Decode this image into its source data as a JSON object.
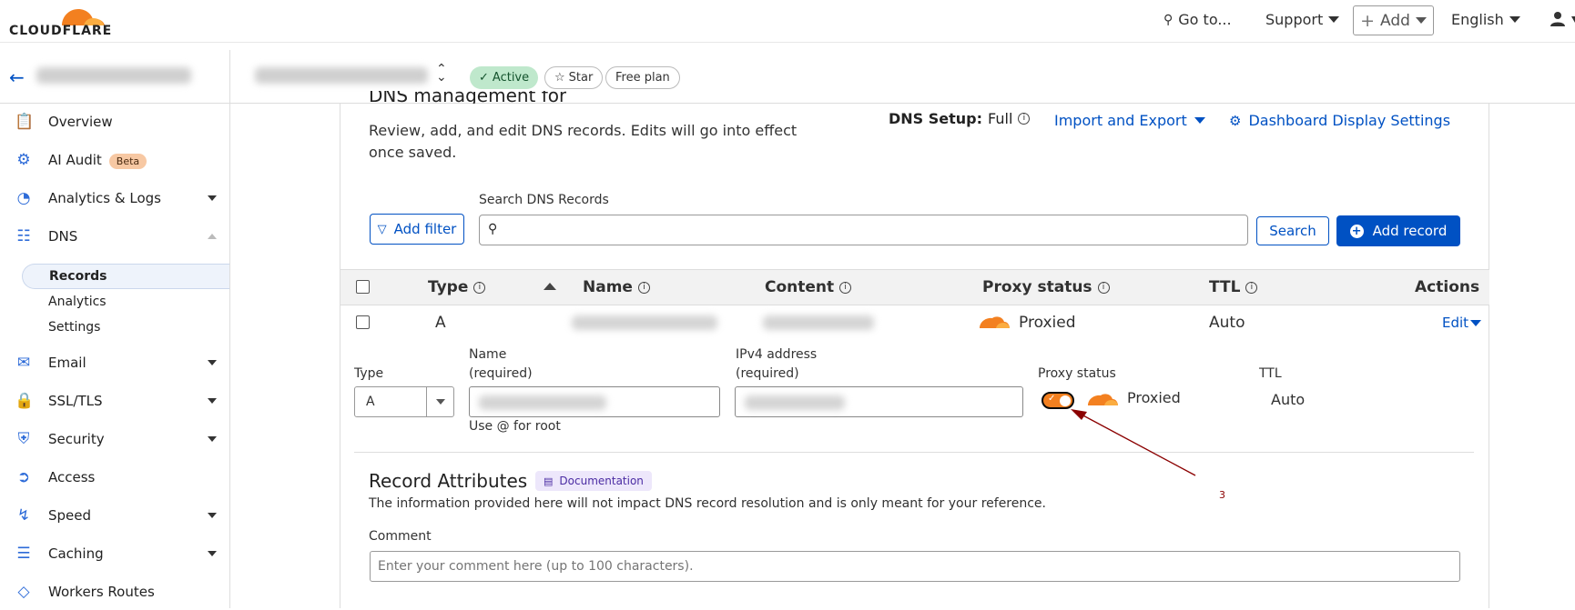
{
  "brand": {
    "logo_text": "CLOUDFLARE",
    "accent": "#f38020",
    "link_color": "#0051c3"
  },
  "topnav": {
    "goto": "Go to...",
    "support": "Support",
    "add": "Add",
    "language": "English"
  },
  "zone": {
    "status": "Active",
    "star": "Star",
    "plan": "Free plan"
  },
  "sidebar": {
    "items": [
      {
        "label": "Overview",
        "icon": "clipboard-icon"
      },
      {
        "label": "AI Audit",
        "icon": "robot-icon",
        "badge": "Beta"
      },
      {
        "label": "Analytics & Logs",
        "icon": "pie-chart-icon"
      },
      {
        "label": "DNS",
        "icon": "network-icon"
      },
      {
        "label": "Email",
        "icon": "envelope-icon"
      },
      {
        "label": "SSL/TLS",
        "icon": "lock-icon"
      },
      {
        "label": "Security",
        "icon": "shield-icon"
      },
      {
        "label": "Access",
        "icon": "access-icon"
      },
      {
        "label": "Speed",
        "icon": "bolt-icon"
      },
      {
        "label": "Caching",
        "icon": "storage-icon"
      },
      {
        "label": "Workers Routes",
        "icon": "diamond-icon"
      }
    ],
    "dns_sub": [
      "Records",
      "Analytics",
      "Settings"
    ]
  },
  "main": {
    "title": "DNS management for",
    "description": "Review, add, and edit DNS records. Edits will go into effect once saved.",
    "dns_setup_label": "DNS Setup:",
    "dns_setup_value": "Full",
    "import_export": "Import and Export",
    "display_settings": "Dashboard Display Settings",
    "add_filter": "Add filter",
    "search_label": "Search DNS Records",
    "search_button": "Search",
    "add_record": "Add record"
  },
  "table": {
    "headers": {
      "type": "Type",
      "name": "Name",
      "content": "Content",
      "proxy": "Proxy status",
      "ttl": "TTL",
      "actions": "Actions"
    },
    "row": {
      "type": "A",
      "proxy": "Proxied",
      "ttl": "Auto",
      "edit": "Edit"
    }
  },
  "edit_form": {
    "type_label": "Type",
    "type_value": "A",
    "name_label_1": "Name",
    "name_label_2": "(required)",
    "name_hint": "Use @ for root",
    "ipv4_label_1": "IPv4 address",
    "ipv4_label_2": "(required)",
    "proxy_label": "Proxy status",
    "proxy_value": "Proxied",
    "ttl_label": "TTL",
    "ttl_value": "Auto"
  },
  "attributes": {
    "title": "Record Attributes",
    "doc_link": "Documentation",
    "description": "The information provided here will not impact DNS record resolution and is only meant for your reference.",
    "comment_label": "Comment",
    "comment_placeholder": "Enter your comment here (up to 100 characters)."
  },
  "annotation": {
    "number": "3"
  }
}
